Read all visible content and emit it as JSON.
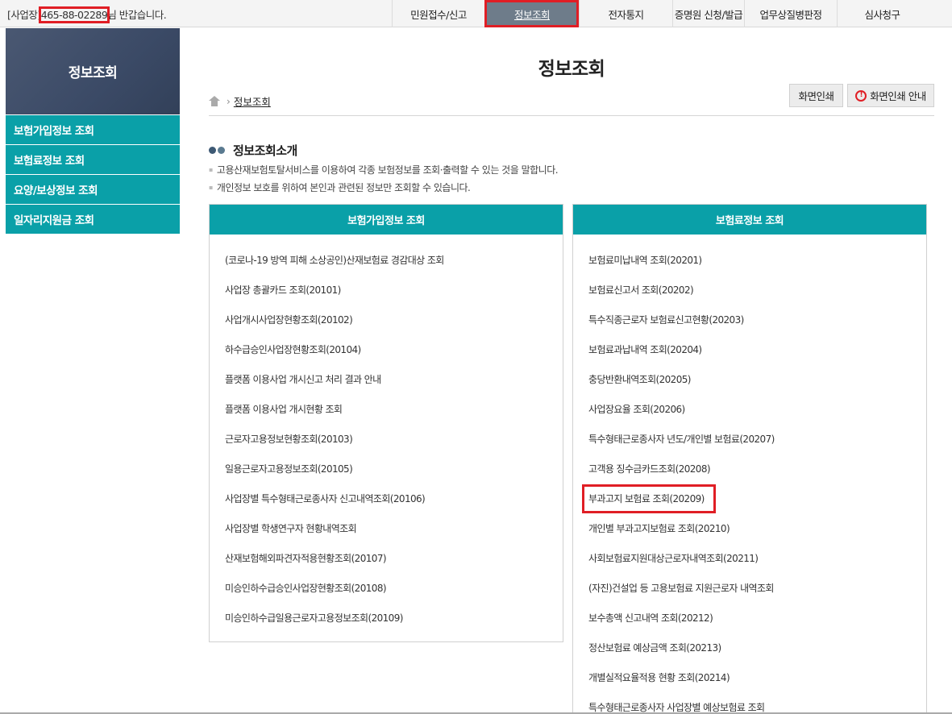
{
  "header": {
    "greeting_prefix": "[사업장]",
    "business_no": "465-88-02289",
    "greeting_suffix": "님 반갑습니다.",
    "nav": [
      {
        "label": "민원접수/신고",
        "width": 115
      },
      {
        "label": "정보조회",
        "width": 117,
        "active": true
      },
      {
        "label": "전자통지",
        "width": 116
      },
      {
        "label": "증명원 신청/발급",
        "width": 89
      },
      {
        "label": "업무상질병판정",
        "width": 115
      },
      {
        "label": "심사청구",
        "width": 112
      }
    ]
  },
  "sidebar": {
    "title": "정보조회",
    "items": [
      "보험가입정보 조회",
      "보험료정보 조회",
      "요양/보상정보 조회",
      "일자리지원금 조회"
    ]
  },
  "main": {
    "title": "정보조회",
    "breadcrumb": "정보조회",
    "print_label": "화면인쇄",
    "guide_label": "화면인쇄 안내",
    "section_title": "정보조회소개",
    "desc1": "고용산재보험토탈서비스를 이용하여 각종 보험정보를 조회·출력할 수 있는 것을 말합니다.",
    "desc2": "개인정보 보호를 위하여 본인과 관련된 정보만 조회할 수 있습니다."
  },
  "left_panel": {
    "title": "보험가입정보 조회",
    "items": [
      "(코로나-19 방역 피해 소상공인)산재보험료 경감대상 조회",
      "사업장 총괄카드 조회(20101)",
      "사업개시사업장현황조회(20102)",
      "하수급승인사업장현황조회(20104)",
      "플랫폼 이용사업 개시신고 처리 결과 안내",
      "플랫폼 이용사업 개시현황 조회",
      "근로자고용정보현황조회(20103)",
      "일용근로자고용정보조회(20105)",
      "사업장별 특수형태근로종사자 신고내역조회(20106)",
      "사업장별 학생연구자 현황내역조회",
      "산재보험해외파견자적용현황조회(20107)",
      "미승인하수급승인사업장현황조회(20108)",
      "미승인하수급일용근로자고용정보조회(20109)"
    ]
  },
  "right_panel": {
    "title": "보험료정보 조회",
    "highlight_index": 8,
    "items": [
      "보험료미납내역 조회(20201)",
      "보험료신고서 조회(20202)",
      "특수직종근로자 보험료신고현황(20203)",
      "보험료과납내역 조회(20204)",
      "충당반환내역조회(20205)",
      "사업장요율 조회(20206)",
      "특수형태근로종사자 년도/개인별 보험료(20207)",
      "고객용 징수금카드조회(20208)",
      "부과고지 보험료 조회(20209)",
      "개인별 부과고지보험료 조회(20210)",
      "사회보험료지원대상근로자내역조회(20211)",
      "(자진)건설업 등 고용보험료 지원근로자 내역조회",
      "보수총액 신고내역 조회(20212)",
      "정산보험료 예상금액 조회(20213)",
      "개별실적요율적용 현황 조회(20214)",
      "특수형태근로종사자 사업장별 예상보험료 조회"
    ]
  }
}
